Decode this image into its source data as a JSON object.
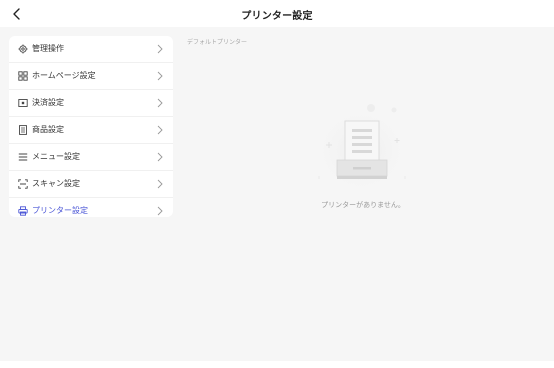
{
  "header": {
    "title": "プリンター設定"
  },
  "menu": {
    "items": [
      {
        "label": "管理操作",
        "icon": "gear-icon",
        "active": false
      },
      {
        "label": "ホームページ設定",
        "icon": "grid-icon",
        "active": false
      },
      {
        "label": "決済設定",
        "icon": "payment-icon",
        "active": false
      },
      {
        "label": "商品設定",
        "icon": "document-icon",
        "active": false
      },
      {
        "label": "メニュー設定",
        "icon": "list-icon",
        "active": false
      },
      {
        "label": "スキャン設定",
        "icon": "scan-icon",
        "active": false
      },
      {
        "label": "プリンター設定",
        "icon": "printer-icon",
        "active": true
      }
    ]
  },
  "main": {
    "section_label": "デフォルトプリンター",
    "empty_text": "プリンターがありません。"
  },
  "colors": {
    "accent": "#4a55d6",
    "background": "#f6f6f6",
    "panel": "#ffffff"
  }
}
